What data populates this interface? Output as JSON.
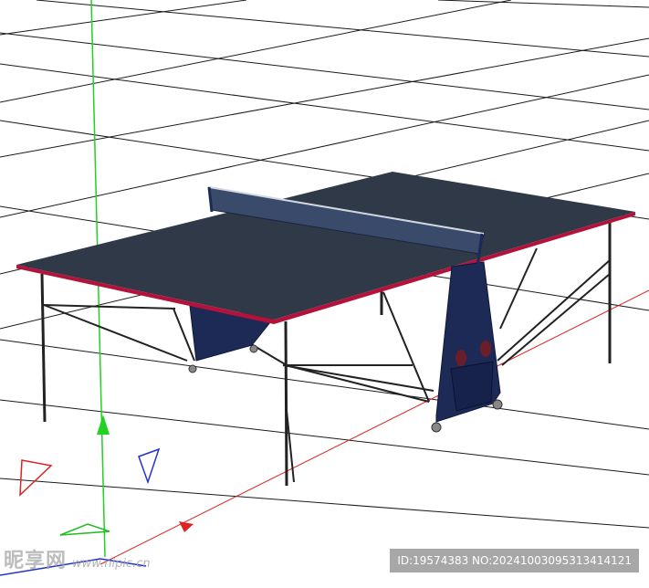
{
  "scene": {
    "object": "ping-pong-table",
    "colors": {
      "background": "#ffffff",
      "grid": "#1a1a1a",
      "table_top": "#2f3947",
      "table_edge": "#b3123a",
      "frame": "#1c2a55",
      "legs": "#222222",
      "axis_y": "#22d122",
      "axis_x": "#dd2222",
      "gizmo_blue": "#2233cc"
    }
  },
  "watermark": {
    "brand": "昵享网",
    "url": "www.nipic.cn"
  },
  "id_bar": {
    "text": "ID:19574383 NO:20241003095313414121"
  }
}
